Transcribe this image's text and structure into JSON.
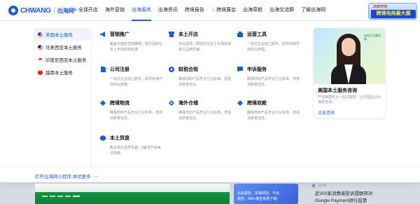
{
  "header": {
    "logo_text": "CHWANG",
    "logo_sub": "出海网",
    "nav": [
      {
        "label": "全球开店",
        "icon": "globe-icon"
      },
      {
        "label": "海外营销"
      },
      {
        "label": "出海服务",
        "active": true
      },
      {
        "label": "出海资讯"
      },
      {
        "label": "跨境报告"
      },
      {
        "label": "跨境展会",
        "icon": "fire-icon"
      },
      {
        "label": "出海导航"
      },
      {
        "label": "出海交流群"
      },
      {
        "label": "了解出海网"
      }
    ],
    "promo_badge": {
      "small": "25年开年",
      "big": "跨境电商最大展"
    }
  },
  "dropdown": {
    "countries": [
      {
        "label": "美国本土服务",
        "flag": "us",
        "active": true
      },
      {
        "label": "马来西亚本土服务",
        "flag": "my"
      },
      {
        "label": "印度尼西亚本土服务",
        "flag": "id"
      },
      {
        "label": "越南本土服务",
        "flag": "vn"
      }
    ],
    "services": [
      {
        "title": "营销推广",
        "icon": "megaphone-icon",
        "desc": "覆盖全面的营销策略，提升品牌在本土市场的知名度。"
      },
      {
        "title": "本土开店",
        "icon": "store-icon",
        "desc": "专业指导，帮助您在本土市场快速建立品牌店铺。"
      },
      {
        "title": "运营工具",
        "icon": "toolbox-icon",
        "desc": "一站式企业成立服务，助您快速开启商业旅程。"
      },
      {
        "title": "公司注册",
        "icon": "document-icon",
        "desc": "一站式企业成立服务，助您快速开启商业旅程。"
      },
      {
        "title": "财税合规",
        "icon": "calculator-icon",
        "desc": "确保您的产品符合行业标准，增强消费者信任。"
      },
      {
        "title": "申诉服务",
        "icon": "chat-icon",
        "desc": "确保您的产品符合行业标准，增强消费者信任。"
      },
      {
        "title": "跨境物流",
        "icon": "truck-icon",
        "desc": "确保您的产品符合行业标准，增强消费者信任。"
      },
      {
        "title": "海外仓储",
        "icon": "warehouse-icon",
        "desc": "确保您的产品符合行业标准，增强消费者信任。"
      },
      {
        "title": "跨境收款",
        "icon": "wallet-icon",
        "desc": "确保您的产品符合行业标准，增强消费者信任。"
      },
      {
        "title": "本土货盘",
        "icon": "box-icon",
        "desc": "集合源头优质货盘，0备货开启美式购物"
      }
    ],
    "promo": {
      "image_text": "自由企业服务商",
      "title": "美国本土服务咨询",
      "desc": "严选美国本土一站式服务，让中国企业出海更容易！",
      "link": "点击咨询"
    },
    "footer_link": "打开出海网小程序,体验更多"
  },
  "background": {
    "card_lines": [
      "出品报告，实操经验，平台",
      "报告，500+报告免费下载!"
    ],
    "news_time": "11:48",
    "news_lines": [
      "近300家消费者投诉提联邦对",
      "Google Payment进行监管"
    ]
  },
  "colors": {
    "brand": "#1e5bd6",
    "accent_orange": "#ff5b1a",
    "muted_text": "#8a8f99"
  }
}
